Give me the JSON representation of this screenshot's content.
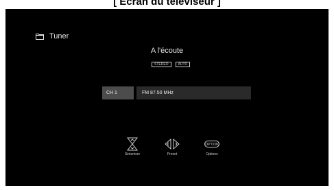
{
  "caption": "[ Écran du téléviseur ]",
  "source": {
    "label": "Tuner",
    "icon": "folder-icon"
  },
  "status": {
    "text": "A l'écoute",
    "badges": [
      "STEREO",
      "AUTO"
    ]
  },
  "channel": {
    "number": "CH 1",
    "frequency": "FM 87.50 MHz"
  },
  "hints": [
    {
      "label": "Sintoniser",
      "icon": "up-down-arrows-icon"
    },
    {
      "label": "Preset",
      "icon": "left-right-arrows-icon"
    },
    {
      "label": "Options",
      "icon": "option-button-icon",
      "key": "OPTION"
    }
  ],
  "colors": {
    "screen": "#000000",
    "text": "#e6e6e6",
    "channel_number_bg": "#4c4c4c",
    "channel_freq_bg": "#2a2a2a"
  }
}
